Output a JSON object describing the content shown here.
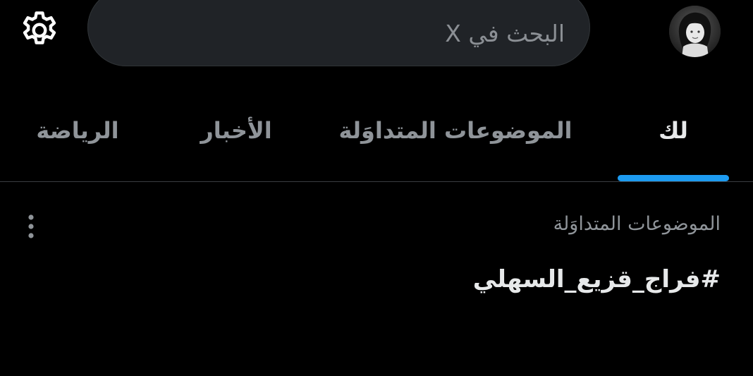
{
  "header": {
    "search": {
      "placeholder": "البحث في X",
      "value": ""
    },
    "settings_icon": "gear-icon",
    "avatar_icon": "user-avatar"
  },
  "tabs": [
    {
      "label": "لك",
      "active": true
    },
    {
      "label": "الموضوعات المتداوَلة",
      "active": false
    },
    {
      "label": "الأخبار",
      "active": false
    },
    {
      "label": "الرياضة",
      "active": false
    }
  ],
  "trend": {
    "context": "الموضوعات المتداوَلة",
    "name": "#فراج_قزيع_السهلي",
    "more_icon": "vertical-ellipsis-icon"
  },
  "colors": {
    "background": "#000000",
    "accent": "#1d9bf0",
    "primary_text": "#e7e9ea",
    "secondary_text": "#8f9499",
    "search_background": "#202327"
  }
}
